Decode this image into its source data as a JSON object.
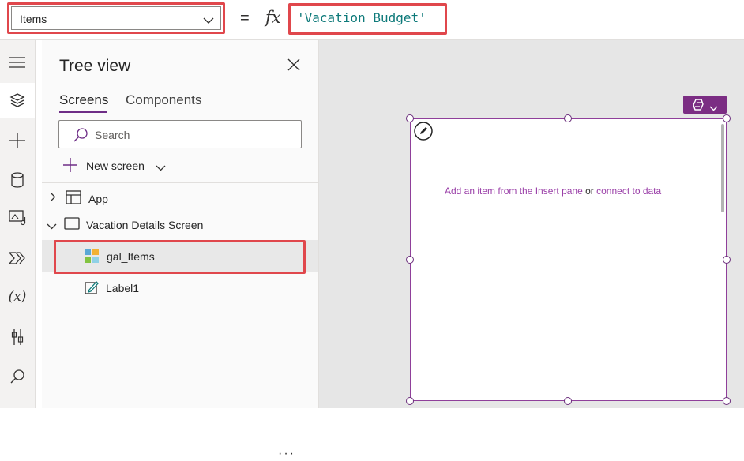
{
  "formula_bar": {
    "property": "Items",
    "equals": "=",
    "fx": "fx",
    "formula": "'Vacation Budget'"
  },
  "rail": {
    "icons": [
      "hamburger-icon",
      "tree-view-icon",
      "insert-icon",
      "data-icon",
      "media-icon",
      "power-automate-icon",
      "variables-icon",
      "advanced-tools-icon",
      "search-icon"
    ],
    "variables_label": "(x)"
  },
  "tree": {
    "title": "Tree view",
    "tabs": [
      "Screens",
      "Components"
    ],
    "search_placeholder": "Search",
    "new_screen": "New screen",
    "nodes": {
      "app": "App",
      "screen": "Vacation Details Screen",
      "gallery": "gal_Items",
      "label": "Label1"
    },
    "more": "···"
  },
  "canvas": {
    "hint_part1": "Add an item from the Insert pane",
    "hint_or": "or",
    "hint_part2": "connect to data"
  },
  "colors": {
    "accent": "#6e2d86",
    "highlight": "#e0474c",
    "formula_text": "#0e7a7a",
    "hint_text": "#9a3fa8"
  }
}
